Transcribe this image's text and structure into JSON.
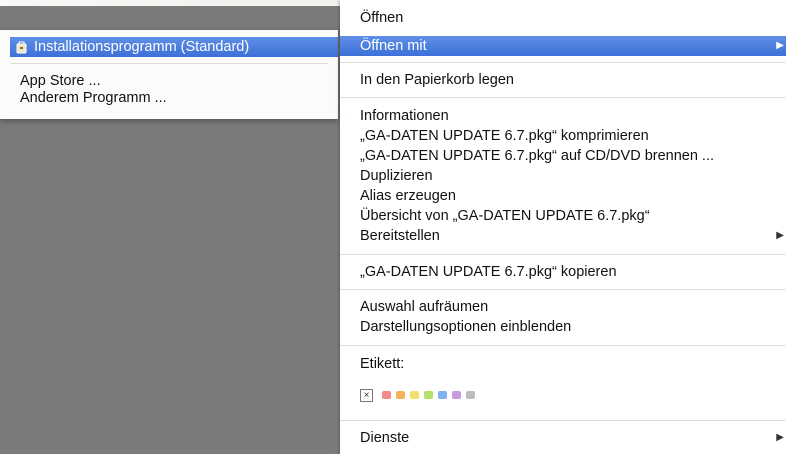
{
  "submenu": {
    "items": [
      {
        "label": "Installationsprogramm (Standard)",
        "highlighted": true,
        "icon": "package-icon"
      },
      {
        "label": "App Store ..."
      },
      {
        "label": "Anderem Programm ..."
      }
    ]
  },
  "menu": {
    "open": "Öffnen",
    "open_with": "Öffnen mit",
    "trash": "In den Papierkorb legen",
    "info": "Informationen",
    "compress": "„GA-DATEN UPDATE 6.7.pkg“ komprimieren",
    "burn": "„GA-DATEN UPDATE 6.7.pkg“ auf CD/DVD brennen ...",
    "duplicate": "Duplizieren",
    "alias": "Alias erzeugen",
    "quicklook": "Übersicht von „GA-DATEN UPDATE 6.7.pkg“",
    "share": "Bereitstellen",
    "copy": "„GA-DATEN UPDATE 6.7.pkg“ kopieren",
    "cleanup": "Auswahl aufräumen",
    "view_options": "Darstellungsoptionen einblenden",
    "label_heading": "Etikett:",
    "services": "Dienste"
  },
  "tag_colors": {
    "none": "×",
    "colors": [
      "#f28a8a",
      "#f5b25a",
      "#f2e06a",
      "#b8e06a",
      "#7fb1f2",
      "#c79ae0",
      "#bdbdbd"
    ]
  },
  "colors": {
    "highlight": "#3d70d8",
    "gray_backdrop": "#7b7b7b"
  }
}
